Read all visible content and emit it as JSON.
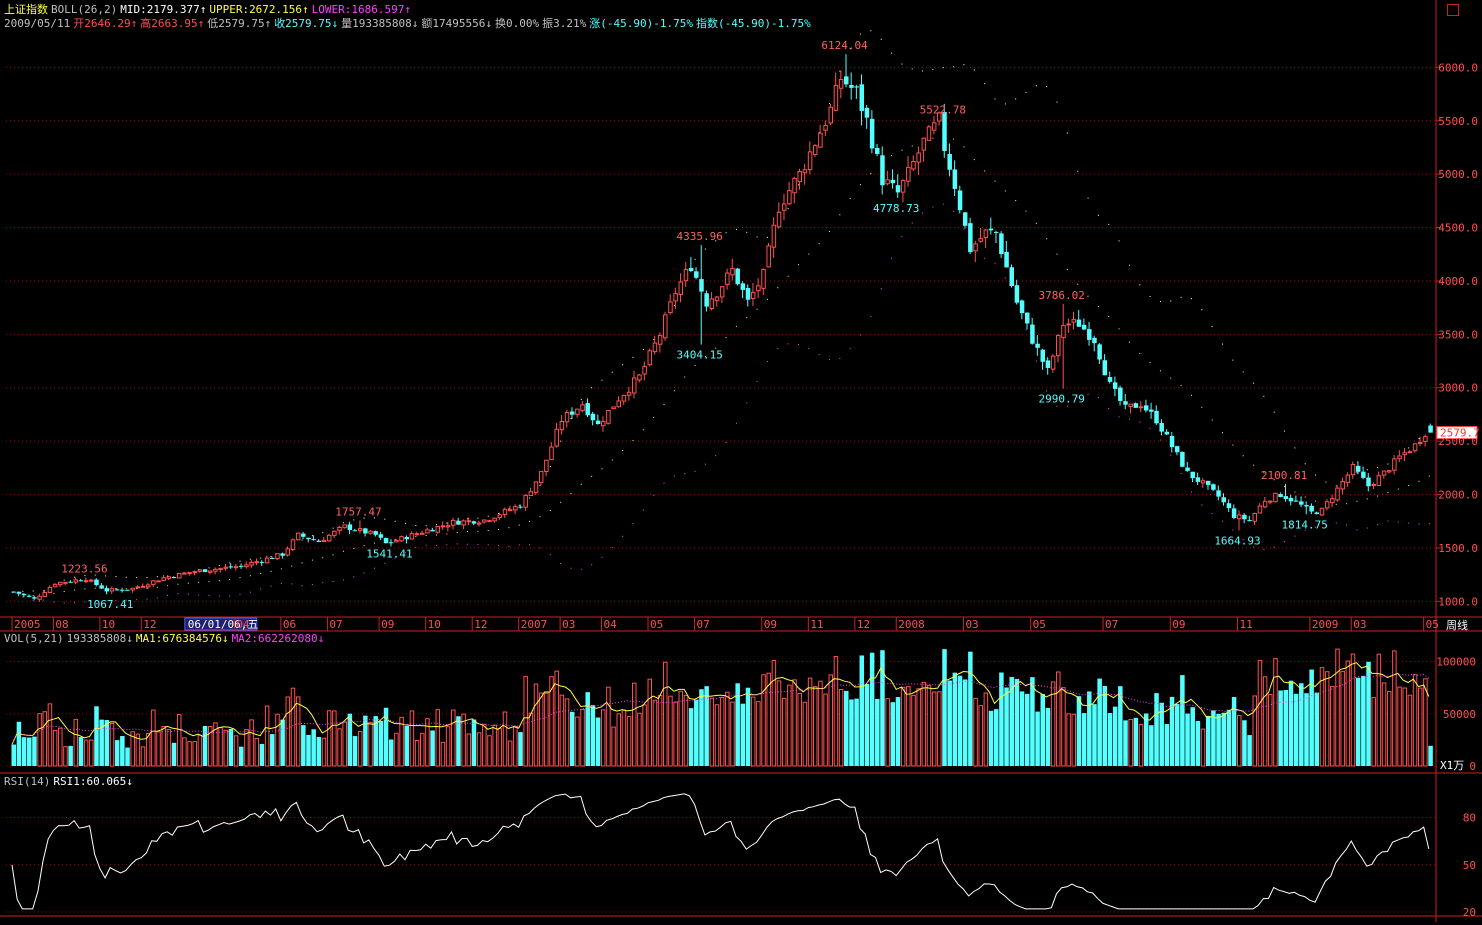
{
  "header": {
    "index_name": "上证指数",
    "boll_label": "BOLL(26,2)",
    "mid": "MID:2179.377↑",
    "upper": "UPPER:2672.156↑",
    "lower": "LOWER:1686.597↑",
    "date": "2009/05/11",
    "open": "开2646.29↑",
    "high": "高2663.95↑",
    "low": "低2579.75↑",
    "close": "收2579.75↓",
    "volume": "量193385808↓",
    "amount": "额17495556↓",
    "turnover": "换0.00%",
    "amplitude": "振3.21%",
    "change": "涨(-45.90)-1.75%",
    "index_change": "指数(-45.90)-1.75%"
  },
  "volume_header": {
    "label": "VOL(5,21)",
    "value": "193385808↓",
    "ma1": "MA1:676384576↓",
    "ma2": "MA2:662262080↓"
  },
  "rsi_header": {
    "label": "RSI(14)",
    "value": "RSI1:60.065↓"
  },
  "side": {
    "period_label": "周线",
    "volume_unit": "X1万",
    "price_tag": "2579.7"
  },
  "colors": {
    "up": "#ff5050",
    "down": "#54ffff",
    "mid": "#ffff40",
    "upper": "#ffffff",
    "lower": "#ff40ff",
    "grid": "#b00000",
    "axis": "#cc2020"
  },
  "chart_data": [
    {
      "type": "candlestick",
      "panel": "price",
      "title": "上证指数",
      "ylim": [
        900,
        6350
      ],
      "y_ticks": [
        "1000.0",
        "1500.0",
        "2000.0",
        "2500.0",
        "3000.0",
        "3500.0",
        "4000.0",
        "4500.0",
        "5000.0",
        "5500.0",
        "6000.0"
      ],
      "x_tick_labels": [
        "2005",
        "08",
        "10",
        "12",
        "06/01/06,五",
        "04",
        "06",
        "07",
        "09",
        "10",
        "12",
        "2007",
        "03",
        "04",
        "05",
        "07",
        "09",
        "11",
        "12",
        "2008",
        "03",
        "05",
        "07",
        "09",
        "11",
        "2009",
        "03",
        "05"
      ],
      "x_tick_index": [
        0,
        8,
        17,
        25,
        34,
        43,
        52,
        61,
        71,
        80,
        89,
        98,
        106,
        114,
        123,
        132,
        145,
        154,
        163,
        171,
        184,
        197,
        211,
        224,
        237,
        251,
        259,
        273
      ],
      "cursor_date": "06/01/06,五",
      "anchors": [
        [
          0,
          1090
        ],
        [
          4,
          1020
        ],
        [
          6,
          1095
        ],
        [
          8,
          1170
        ],
        [
          14,
          1210
        ],
        [
          18,
          1100
        ],
        [
          23,
          1120
        ],
        [
          29,
          1220
        ],
        [
          35,
          1280
        ],
        [
          44,
          1330
        ],
        [
          52,
          1440
        ],
        [
          55,
          1620
        ],
        [
          59,
          1560
        ],
        [
          64,
          1700
        ],
        [
          70,
          1620
        ],
        [
          72,
          1540
        ],
        [
          79,
          1650
        ],
        [
          85,
          1740
        ],
        [
          91,
          1760
        ],
        [
          98,
          1900
        ],
        [
          102,
          2200
        ],
        [
          106,
          2700
        ],
        [
          110,
          2850
        ],
        [
          113,
          2650
        ],
        [
          117,
          2900
        ],
        [
          121,
          3100
        ],
        [
          125,
          3500
        ],
        [
          128,
          3900
        ],
        [
          131,
          4150
        ],
        [
          134,
          3800
        ],
        [
          136,
          3900
        ],
        [
          139,
          4100
        ],
        [
          142,
          3800
        ],
        [
          145,
          4050
        ],
        [
          148,
          4700
        ],
        [
          152,
          5000
        ],
        [
          155,
          5300
        ],
        [
          158,
          5600
        ],
        [
          160,
          5900
        ],
        [
          163,
          5760
        ],
        [
          165,
          5500
        ],
        [
          168,
          4950
        ],
        [
          171,
          4820
        ],
        [
          173,
          5000
        ],
        [
          176,
          5300
        ],
        [
          179,
          5500
        ],
        [
          180,
          5250
        ],
        [
          182,
          4900
        ],
        [
          185,
          4300
        ],
        [
          188,
          4450
        ],
        [
          190,
          4450
        ],
        [
          194,
          3800
        ],
        [
          197,
          3450
        ],
        [
          200,
          3150
        ],
        [
          203,
          3600
        ],
        [
          206,
          3600
        ],
        [
          209,
          3450
        ],
        [
          212,
          3020
        ],
        [
          215,
          2800
        ],
        [
          218,
          2850
        ],
        [
          221,
          2700
        ],
        [
          224,
          2450
        ],
        [
          227,
          2200
        ],
        [
          230,
          2100
        ],
        [
          233,
          1980
        ],
        [
          236,
          1800
        ],
        [
          239,
          1760
        ],
        [
          242,
          1950
        ],
        [
          245,
          2000
        ],
        [
          248,
          1930
        ],
        [
          251,
          1830
        ],
        [
          253,
          1850
        ],
        [
          256,
          2050
        ],
        [
          259,
          2250
        ],
        [
          262,
          2080
        ],
        [
          265,
          2200
        ],
        [
          268,
          2350
        ],
        [
          271,
          2460
        ],
        [
          273,
          2580
        ]
      ],
      "n_candles": 275,
      "annotations": [
        {
          "label": "1223.56",
          "i": 14,
          "value": 1223.56,
          "kind": "high"
        },
        {
          "label": "1067.41",
          "i": 19,
          "value": 1067.41,
          "kind": "low"
        },
        {
          "label": "1757.47",
          "i": 67,
          "value": 1757.47,
          "kind": "high"
        },
        {
          "label": "1541.41",
          "i": 73,
          "value": 1541.41,
          "kind": "low"
        },
        {
          "label": "4335.96",
          "i": 133,
          "value": 4335.96,
          "kind": "high"
        },
        {
          "label": "3404.15",
          "i": 133,
          "value": 3404.15,
          "kind": "low"
        },
        {
          "label": "6124.04",
          "i": 161,
          "value": 6124.04,
          "kind": "high"
        },
        {
          "label": "4778.73",
          "i": 171,
          "value": 4778.73,
          "kind": "low"
        },
        {
          "label": "5522.78",
          "i": 180,
          "value": 5522.78,
          "kind": "high"
        },
        {
          "label": "2990.79",
          "i": 203,
          "value": 2990.79,
          "kind": "low"
        },
        {
          "label": "3786.02",
          "i": 203,
          "value": 3786.02,
          "kind": "high"
        },
        {
          "label": "1664.93",
          "i": 237,
          "value": 1664.93,
          "kind": "low"
        },
        {
          "label": "2100.81",
          "i": 246,
          "value": 2100.81,
          "kind": "high"
        },
        {
          "label": "1814.75",
          "i": 250,
          "value": 1814.75,
          "kind": "low"
        }
      ],
      "bollinger": {
        "period": 26,
        "k": 2,
        "mid_last": 2179.377,
        "upper_last": 2672.156,
        "lower_last": 1686.597
      },
      "last_close": 2579.75
    },
    {
      "type": "bar",
      "panel": "volume",
      "title": "VOL(5,21)",
      "ylim": [
        0,
        115000
      ],
      "y_ticks": [
        "0",
        "50000",
        "100000"
      ],
      "unit": "X1万",
      "last": 193385808,
      "ma1_last": 676384576,
      "ma2_last": 662262080
    },
    {
      "type": "line",
      "panel": "rsi",
      "title": "RSI(14)",
      "ylim": [
        20,
        100
      ],
      "y_ticks": [
        "20",
        "50",
        "80"
      ],
      "last": 60.065
    }
  ]
}
